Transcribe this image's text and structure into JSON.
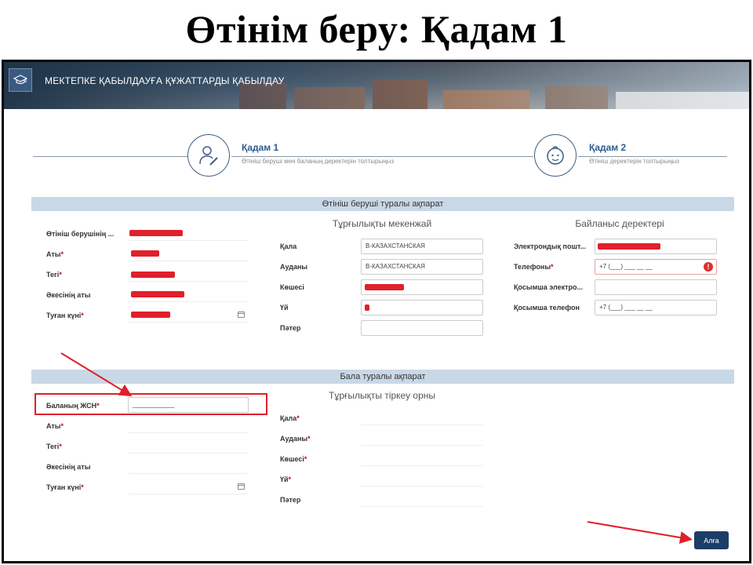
{
  "slide": {
    "title": "Өтінім беру: Қадам 1"
  },
  "banner": {
    "title": "МЕКТЕПКЕ ҚАБЫЛДАУҒА ҚҰЖАТТАРДЫ ҚАБЫЛДАУ",
    "logo_icon": "graduation-cap-icon"
  },
  "steps": [
    {
      "title": "Қадам 1",
      "subtitle": "Өтініш беруші мен баланың деректерін толтырыңыз",
      "icon": "person-edit-icon",
      "active": true
    },
    {
      "title": "Қадам 2",
      "subtitle": "Өтініш деректерін толтырыңыз",
      "icon": "child-face-icon",
      "active": false
    }
  ],
  "applicant": {
    "section_title": "Өтініш беруші туралы ақпарат",
    "fields": [
      {
        "label": "Өтініш берушінің ...",
        "required": false
      },
      {
        "label": "Аты",
        "required": true
      },
      {
        "label": "Тегі",
        "required": true
      },
      {
        "label": "Әкесінің аты",
        "required": false
      },
      {
        "label": "Туған күні",
        "required": true
      }
    ],
    "address": {
      "title": "Тұрғылықты мекенжай",
      "fields": [
        {
          "label": "Қала",
          "value": "В-КАЗАХСТАНСКАЯ"
        },
        {
          "label": "Ауданы",
          "value": "В-КАЗАХСТАНСКАЯ"
        },
        {
          "label": "Көшесі",
          "value": ""
        },
        {
          "label": "Үй",
          "value": ""
        },
        {
          "label": "Пәтер",
          "value": ""
        }
      ]
    },
    "contacts": {
      "title": "Байланыс деректері",
      "fields": [
        {
          "label": "Электрондық пошт...",
          "required": false,
          "value": ""
        },
        {
          "label": "Телефоны",
          "required": true,
          "value": "+7 (___) ___ __ __"
        },
        {
          "label": "Қосымша электро...",
          "required": false,
          "value": ""
        },
        {
          "label": "Қосымша телефон",
          "required": false,
          "value": "+7 (___) ___ __ __"
        }
      ]
    }
  },
  "child": {
    "section_title": "Бала туралы ақпарат",
    "fields": [
      {
        "label": "Баланың ЖСН",
        "required": true,
        "value": "____________"
      },
      {
        "label": "Аты",
        "required": true
      },
      {
        "label": "Тегі",
        "required": true
      },
      {
        "label": "Әкесінің аты",
        "required": false
      },
      {
        "label": "Туған күні",
        "required": true
      }
    ],
    "registration": {
      "title": "Тұрғылықты тіркеу орны",
      "fields": [
        {
          "label": "Қала",
          "required": true
        },
        {
          "label": "Ауданы",
          "required": true
        },
        {
          "label": "Көшесі",
          "required": true
        },
        {
          "label": "Үй",
          "required": true
        },
        {
          "label": "Пәтер",
          "required": false
        }
      ]
    }
  },
  "actions": {
    "next_label": "Алға"
  },
  "colors": {
    "accent": "#1b3e66",
    "section_bar": "#c9d8e6",
    "required": "#d0021b",
    "annotation": "#e0202a"
  }
}
